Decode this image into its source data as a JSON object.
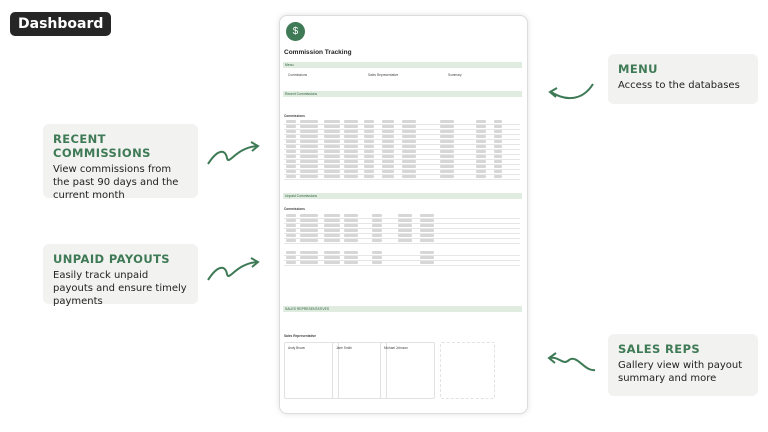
{
  "badge": {
    "label": "Dashboard"
  },
  "callouts": {
    "recent": {
      "title": "RECENT COMMISSIONS",
      "body": "View commissions from the past 90 days and the current month"
    },
    "unpaid": {
      "title": "UNPAID PAYOUTS",
      "body": "Easily track unpaid payouts and ensure timely payments"
    },
    "menu": {
      "title": "MENU",
      "body": "Access to the databases"
    },
    "reps": {
      "title": "SALES REPS",
      "body": "Gallery view with payout summary and more"
    }
  },
  "notion": {
    "title": "Commission Tracking",
    "menu_section": "Menu",
    "menu_items": [
      "Commissions",
      "Sales Representative",
      "Summary"
    ],
    "recent_section": "Recent Commissions",
    "recent_table": "Commissions",
    "unpaid_section": "Unpaid Commissions",
    "unpaid_table": "Commissions",
    "reps_section": "SALES REPRESENTATIVES",
    "reps_table": "Sales Representative",
    "reps_names": [
      "Andy Brown",
      "Jane Smith",
      "Michael Johnson"
    ]
  },
  "colors": {
    "accent": "#3e7a55",
    "card_bg": "#f2f2f0",
    "badge_bg": "#262626"
  }
}
